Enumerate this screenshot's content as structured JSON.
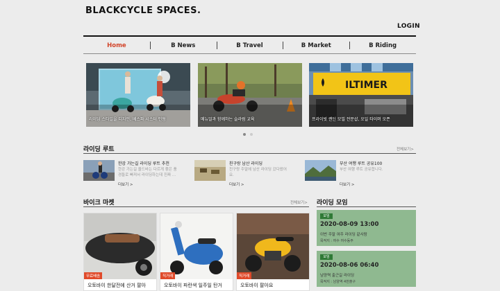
{
  "header": {
    "logo": "BLACKCYCLE SPACES.",
    "login": "LOGIN"
  },
  "nav": {
    "items": [
      {
        "label": "Home",
        "active": true
      },
      {
        "label": "B News",
        "active": false
      },
      {
        "label": "B Travel",
        "active": false
      },
      {
        "label": "B Market",
        "active": false
      },
      {
        "label": "B Riding",
        "active": false
      }
    ],
    "active_color": "#d2452a"
  },
  "slider": {
    "slides": [
      {
        "caption": "라이딩 스타일을 디자인, 베스파 시스터 인형"
      },
      {
        "caption": "메뉴얼과 함께하는 슬라럼 교육"
      },
      {
        "caption": "프라이빗 랜딘 모빌 전문샵, 오일 타이머 오픈",
        "sign": "ILTIMER"
      }
    ],
    "current_index": 0,
    "dot_count": 2
  },
  "riding_route": {
    "title": "라이딩 루트",
    "more": "전체보기>",
    "items": [
      {
        "title": "한강 가는길 라이딩 루트 추천",
        "desc1": "한강 가는길 올드바는 다르게 좋은 풍",
        "desc2": "경들로 빠져서 라이딩하는데 진짜 ...",
        "more": "더보기 >"
      },
      {
        "title": "친구랑 남산 라이딩",
        "desc1": "친구랑 주말에 남산 라이딩 갔다왔어",
        "desc2": "요.",
        "more": "더보기 >"
      },
      {
        "title": "부산 여행 루트 공유100",
        "desc1": "부산 여행 루트 공유합니다.",
        "desc2": "",
        "more": "더보기 >"
      }
    ]
  },
  "bike_market": {
    "title": "바이크 마켓",
    "more": "전체보기>",
    "items": [
      {
        "badge": "무료배송",
        "title": "오토바이 한달전에 산거 팔아"
      },
      {
        "badge": "직거래",
        "title": "오토바이 파란색 일주일 탄거"
      },
      {
        "badge": "직거래",
        "title": "오토바이 팔아요"
      }
    ]
  },
  "riding_meet": {
    "title": "라이딩 모임",
    "items": [
      {
        "tag": "모임",
        "date": "2020-08-09 13:00",
        "desc": "이번 주말 여주 라이딩 같사람",
        "sub": "목적지 : 여수 여수동주"
      },
      {
        "tag": "모임",
        "date": "2020-08-06 06:40",
        "desc": "남양역 출근길 라이딩",
        "sub": "목적지 : 남양역 4번출구"
      }
    ],
    "colors": {
      "card": "#8fb990",
      "tag": "#2f7a36"
    }
  }
}
